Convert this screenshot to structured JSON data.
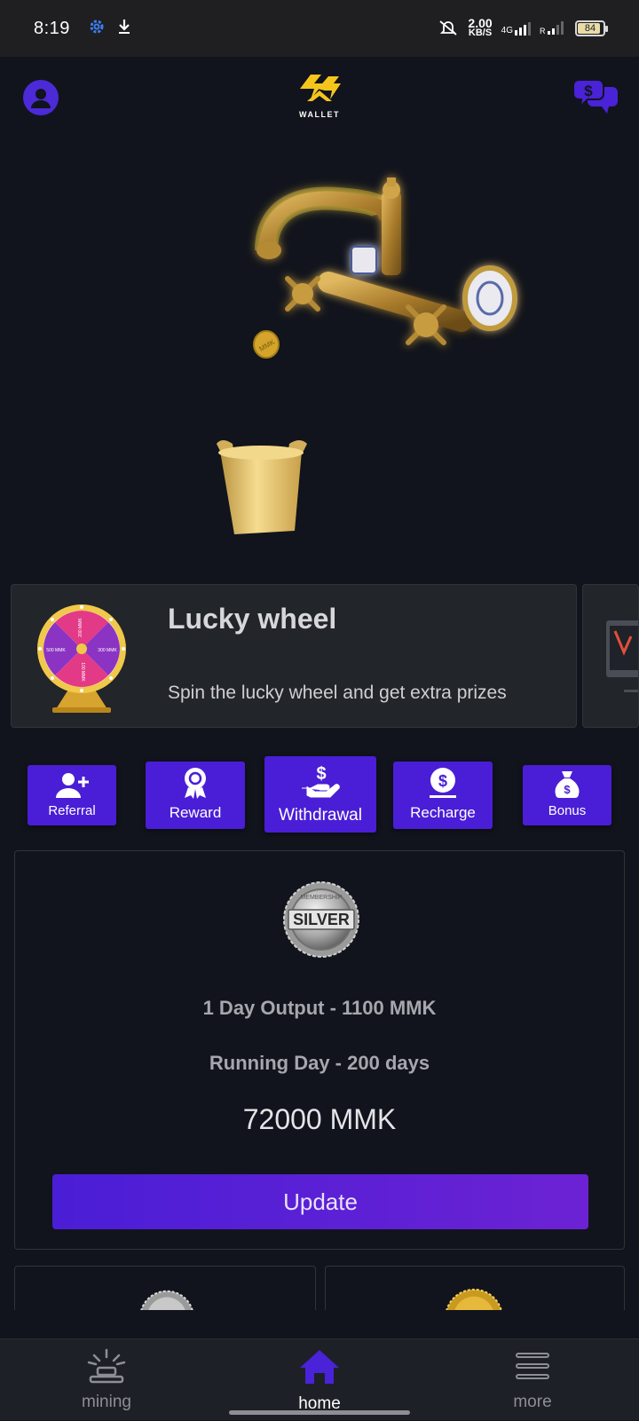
{
  "status_bar": {
    "time": "8:19",
    "net_speed_value": "2.00",
    "net_speed_unit": "KB/S",
    "network_type": "4G",
    "battery": "84",
    "icons": [
      "settings-icon",
      "download-icon",
      "mute-icon",
      "signal-icon"
    ]
  },
  "header": {
    "logo_text": "WALLET",
    "icons": [
      "avatar-icon",
      "chat-dollar-icon"
    ]
  },
  "hero": {
    "coin_text": "MMK"
  },
  "carousel": {
    "title": "Lucky wheel",
    "description": "Spin the lucky wheel and get extra prizes",
    "wheel_labels": [
      "500 MMK",
      "300 MMK",
      "200 MMK",
      "100 MMK"
    ]
  },
  "actions": [
    {
      "label": "Referral",
      "icon": "add-user-icon"
    },
    {
      "label": "Reward",
      "icon": "award-icon"
    },
    {
      "label": "Withdrawal",
      "icon": "hand-dollar-icon"
    },
    {
      "label": "Recharge",
      "icon": "coin-dollar-icon"
    },
    {
      "label": "Bonus",
      "icon": "money-bag-icon"
    }
  ],
  "plan": {
    "badge_text": "SILVER",
    "badge_ring_text": "MEMBERSHIP",
    "daily_output": "1 Day Output - 1100 MMK",
    "running_days": "Running Day - 200 days",
    "price": "72000 MMK",
    "button_label": "Update"
  },
  "colors": {
    "accent": "#4a1ed6",
    "background": "#11141c",
    "card": "#222529",
    "gold": "#d4a52a"
  },
  "bottom_nav": [
    {
      "label": "mining",
      "icon": "mining-icon"
    },
    {
      "label": "home",
      "icon": "home-icon"
    },
    {
      "label": "more",
      "icon": "menu-icon"
    }
  ]
}
